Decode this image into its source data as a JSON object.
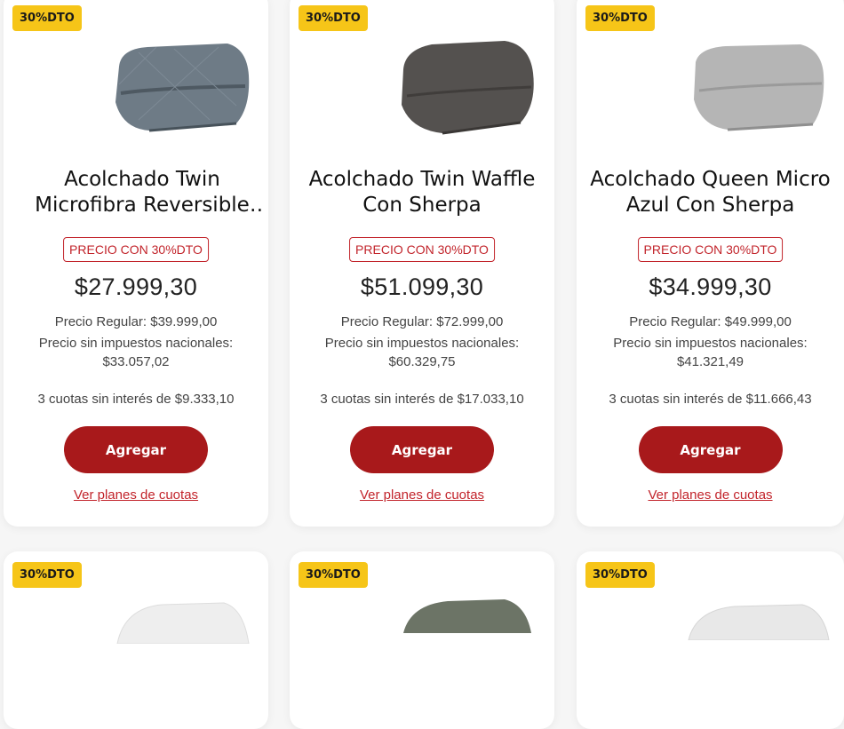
{
  "products_row1": [
    {
      "badge": "30%DTO",
      "title": "Acolchado Twin Microfibra Reversible Gris Con Sherpa",
      "tag": "PRECIO CON 30%DTO",
      "price": "$27.999,30",
      "regular": "Precio Regular: $39.999,00",
      "taxfree_label": "Precio sin impuestos nacionales:",
      "taxfree_value": "$33.057,02",
      "cuotas": "3 cuotas sin interés de $9.333,10",
      "button": "Agregar",
      "link": "Ver planes de cuotas",
      "image_color": "#6e7b86"
    },
    {
      "badge": "30%DTO",
      "title": "Acolchado Twin Waffle Con Sherpa",
      "tag": "PRECIO CON 30%DTO",
      "price": "$51.099,30",
      "regular": "Precio Regular: $72.999,00",
      "taxfree_label": "Precio sin impuestos nacionales:",
      "taxfree_value": "$60.329,75",
      "cuotas": "3 cuotas sin interés de $17.033,10",
      "button": "Agregar",
      "link": "Ver planes de cuotas",
      "image_color": "#54514f"
    },
    {
      "badge": "30%DTO",
      "title": "Acolchado Queen Micro Azul Con Sherpa",
      "tag": "PRECIO CON 30%DTO",
      "price": "$34.999,30",
      "regular": "Precio Regular: $49.999,00",
      "taxfree_label": "Precio sin impuestos nacionales:",
      "taxfree_value": "$41.321,49",
      "cuotas": "3 cuotas sin interés de $11.666,43",
      "button": "Agregar",
      "link": "Ver planes de cuotas",
      "image_color": "#b5b5b5"
    }
  ],
  "products_row2": [
    {
      "badge": "30%DTO",
      "image_color": "#eeeeee"
    },
    {
      "badge": "30%DTO",
      "image_color": "#6c7466"
    },
    {
      "badge": "30%DTO",
      "image_color": "#e8e8e8"
    }
  ],
  "colors": {
    "accent_red": "#a8191b",
    "badge_yellow": "#f6c518",
    "tag_red": "#c2242b"
  }
}
